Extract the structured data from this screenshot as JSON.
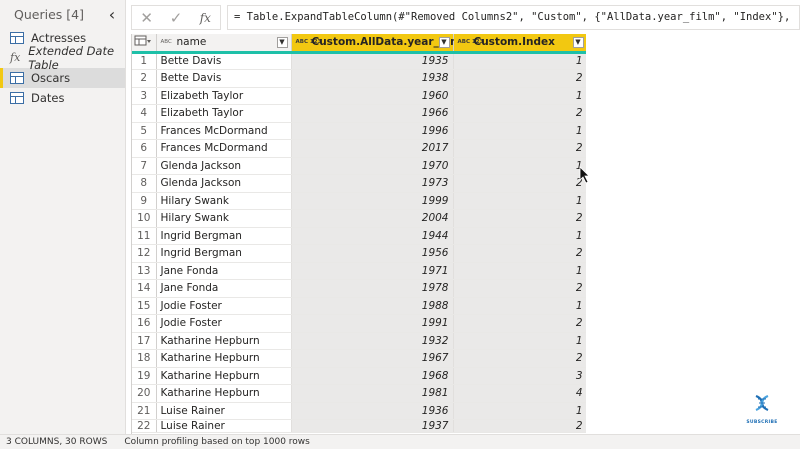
{
  "queries": {
    "title": "Queries [4]",
    "collapse_glyph": "‹",
    "items": [
      {
        "label": "Actresses",
        "icon": "table-icon",
        "selected": false
      },
      {
        "label": "Extended Date Table",
        "icon": "fx-icon",
        "selected": false
      },
      {
        "label": "Oscars",
        "icon": "table-icon",
        "selected": true
      },
      {
        "label": "Dates",
        "icon": "table-icon",
        "selected": false
      }
    ]
  },
  "formula_bar": {
    "cancel_glyph": "✕",
    "confirm_glyph": "✓",
    "fx_label": "fx",
    "formula": "= Table.ExpandTableColumn(#\"Removed Columns2\", \"Custom\", {\"AllData.year_film\", \"Index\"},"
  },
  "grid": {
    "columns": [
      {
        "label": "name",
        "type_badge": "ABC"
      },
      {
        "label": "Custom.AllData.year_film",
        "type_badge": "ABC 123"
      },
      {
        "label": "Custom.Index",
        "type_badge": "ABC 123"
      }
    ],
    "rows": [
      {
        "n": "1",
        "name": "Bette Davis",
        "year": "1935",
        "index": "1"
      },
      {
        "n": "2",
        "name": "Bette Davis",
        "year": "1938",
        "index": "2"
      },
      {
        "n": "3",
        "name": "Elizabeth Taylor",
        "year": "1960",
        "index": "1"
      },
      {
        "n": "4",
        "name": "Elizabeth Taylor",
        "year": "1966",
        "index": "2"
      },
      {
        "n": "5",
        "name": "Frances McDormand",
        "year": "1996",
        "index": "1"
      },
      {
        "n": "6",
        "name": "Frances McDormand",
        "year": "2017",
        "index": "2"
      },
      {
        "n": "7",
        "name": "Glenda Jackson",
        "year": "1970",
        "index": "1"
      },
      {
        "n": "8",
        "name": "Glenda Jackson",
        "year": "1973",
        "index": "2"
      },
      {
        "n": "9",
        "name": "Hilary Swank",
        "year": "1999",
        "index": "1"
      },
      {
        "n": "10",
        "name": "Hilary Swank",
        "year": "2004",
        "index": "2"
      },
      {
        "n": "11",
        "name": "Ingrid Bergman",
        "year": "1944",
        "index": "1"
      },
      {
        "n": "12",
        "name": "Ingrid Bergman",
        "year": "1956",
        "index": "2"
      },
      {
        "n": "13",
        "name": "Jane Fonda",
        "year": "1971",
        "index": "1"
      },
      {
        "n": "14",
        "name": "Jane Fonda",
        "year": "1978",
        "index": "2"
      },
      {
        "n": "15",
        "name": "Jodie Foster",
        "year": "1988",
        "index": "1"
      },
      {
        "n": "16",
        "name": "Jodie Foster",
        "year": "1991",
        "index": "2"
      },
      {
        "n": "17",
        "name": "Katharine Hepburn",
        "year": "1932",
        "index": "1"
      },
      {
        "n": "18",
        "name": "Katharine Hepburn",
        "year": "1967",
        "index": "2"
      },
      {
        "n": "19",
        "name": "Katharine Hepburn",
        "year": "1968",
        "index": "3"
      },
      {
        "n": "20",
        "name": "Katharine Hepburn",
        "year": "1981",
        "index": "4"
      },
      {
        "n": "21",
        "name": "Luise Rainer",
        "year": "1936",
        "index": "1"
      },
      {
        "n": "22",
        "name": "Luise Rainer",
        "year": "1937",
        "index": "2"
      }
    ]
  },
  "logo": {
    "caption": "SUBSCRIBE"
  },
  "status": {
    "summary": "3 COLUMNS, 30 ROWS",
    "profiling": "Column profiling based on top 1000 rows"
  },
  "colors": {
    "selected_header": "#f2c811",
    "header_underline": "#1ec0a8",
    "accent_blue": "#1f6fb5"
  }
}
